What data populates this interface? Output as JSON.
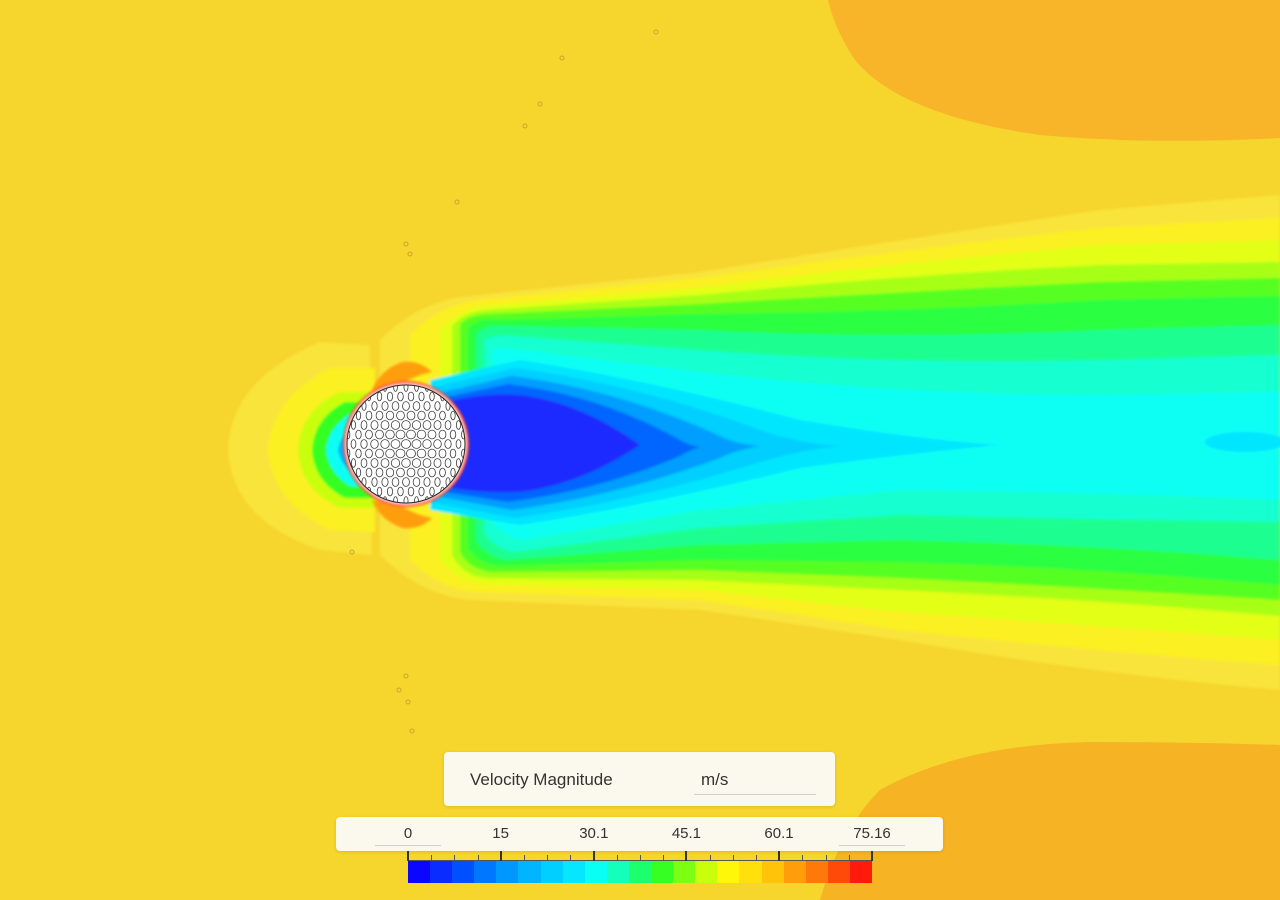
{
  "legend": {
    "title": "Velocity Magnitude",
    "unit": "m/s",
    "tick_labels": [
      "0",
      "15",
      "30.1",
      "45.1",
      "60.1",
      "75.16"
    ],
    "range": [
      0,
      75.16
    ],
    "colors": [
      "#0a06ff",
      "#0a2cff",
      "#0050ff",
      "#0077ff",
      "#0098ff",
      "#00b4ff",
      "#00cfff",
      "#06e6ff",
      "#0afff4",
      "#14ffbc",
      "#1eff6e",
      "#36ff24",
      "#7cff12",
      "#c9ff0a",
      "#fff70a",
      "#ffe00a",
      "#ffc40a",
      "#ff9e0a",
      "#ff780a",
      "#ff4a0a",
      "#ff1a0a"
    ]
  },
  "field": {
    "free_stream_color": "#f6d52c",
    "stagnation_color": "#f8b52a",
    "wake_core_color": "#1f2bff",
    "object": "golf-ball"
  }
}
